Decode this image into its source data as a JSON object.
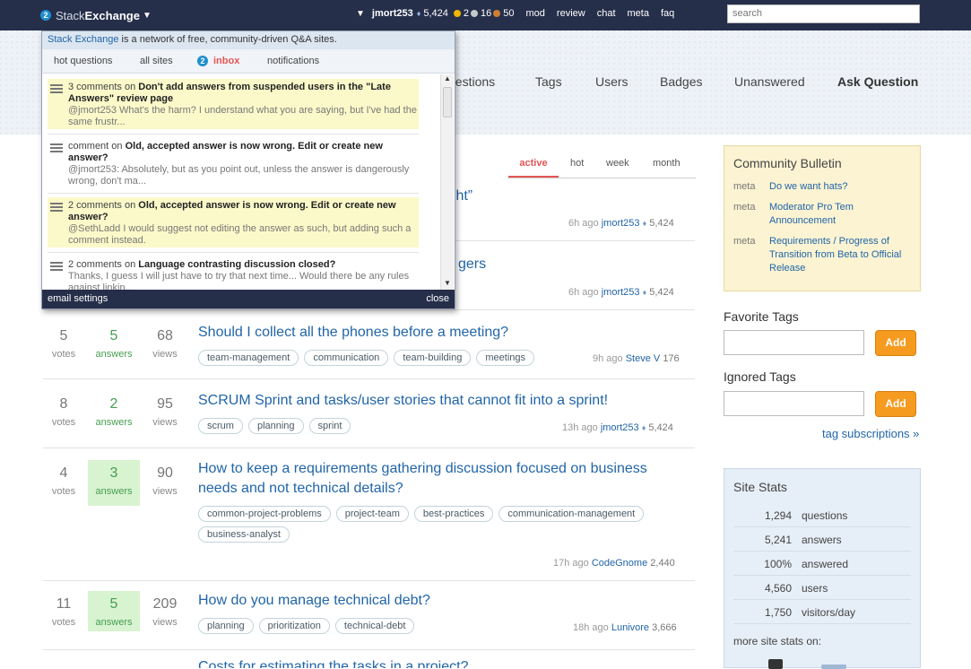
{
  "topbar": {
    "logo_light": "Stack",
    "logo_bold": "Exchange",
    "badge": "2",
    "user": {
      "name": "jmort253",
      "rep": "5,424",
      "gold": "2",
      "silver": "16",
      "bronze": "50"
    },
    "links": [
      "mod",
      "review",
      "chat",
      "meta",
      "faq"
    ],
    "search_placeholder": "search"
  },
  "nav": {
    "questions": "uestions",
    "tags": "Tags",
    "users": "Users",
    "badges": "Badges",
    "unanswered": "Unanswered",
    "ask": "Ask Question"
  },
  "sort_tabs": {
    "active": "active",
    "hot": "hot",
    "week": "week",
    "month": "month"
  },
  "partial_titles": {
    "q1": "ight”",
    "q2": "gers"
  },
  "questions": [
    {
      "meta_time": "6h ago",
      "user": "jmort253",
      "rep": "5,424"
    },
    {
      "meta_time": "6h ago",
      "user": "jmort253",
      "rep": "5,424"
    },
    {
      "votes": "5",
      "answers": "5",
      "views": "68",
      "title": "Should I collect all the phones before a meeting?",
      "tags": [
        "team-management",
        "communication",
        "team-building",
        "meetings"
      ],
      "meta_time": "9h ago",
      "user": "Steve V",
      "rep": "176"
    },
    {
      "votes": "8",
      "answers": "2",
      "views": "95",
      "title": "SCRUM Sprint and tasks/user stories that cannot fit into a sprint!",
      "tags": [
        "scrum",
        "planning",
        "sprint"
      ],
      "meta_time": "13h ago",
      "user": "jmort253",
      "rep": "5,424"
    },
    {
      "votes": "4",
      "answers": "3",
      "views": "90",
      "title": "How to keep a requirements gathering discussion focused on business needs and not technical details?",
      "tags": [
        "common-project-problems",
        "project-team",
        "best-practices",
        "communication-management",
        "business-analyst"
      ],
      "meta_time": "17h ago",
      "user": "CodeGnome",
      "rep": "2,440"
    },
    {
      "votes": "11",
      "answers": "5",
      "views": "209",
      "title": "How do you manage technical debt?",
      "tags": [
        "planning",
        "prioritization",
        "technical-debt"
      ],
      "meta_time": "18h ago",
      "user": "Lunivore",
      "rep": "3,666"
    },
    {
      "title": "Costs for estimating the tasks in a project?"
    }
  ],
  "labels": {
    "votes": "votes",
    "answers": "answers",
    "views": "views"
  },
  "bulletin": {
    "title": "Community Bulletin",
    "items": [
      {
        "site": "meta",
        "text": "Do we want hats?"
      },
      {
        "site": "meta",
        "text": "Moderator Pro Tem Announcement"
      },
      {
        "site": "meta",
        "text": "Requirements / Progress of Transition from Beta to Official Release"
      }
    ]
  },
  "favorite_tags": {
    "label": "Favorite Tags",
    "button": "Add"
  },
  "ignored_tags": {
    "label": "Ignored Tags",
    "button": "Add"
  },
  "tag_subscriptions": "tag subscriptions »",
  "site_stats": {
    "title": "Site Stats",
    "rows": [
      {
        "n": "1,294",
        "l": "questions"
      },
      {
        "n": "5,241",
        "l": "answers"
      },
      {
        "n": "100%",
        "l": "answered"
      },
      {
        "n": "4,560",
        "l": "users"
      },
      {
        "n": "1,750",
        "l": "visitors/day"
      }
    ],
    "more": "more site stats on:"
  },
  "dropdown": {
    "head_link": "Stack Exchange",
    "head_rest": " is a network of free, community-driven Q&A sites.",
    "tabs": [
      "hot questions",
      "all sites",
      "inbox",
      "notifications"
    ],
    "inbox_badge": "2",
    "items": [
      {
        "pre": "3 comments on ",
        "title": "Don't add answers from suspended users in the \"Late Answers\" review page",
        "body": "@jmort253 What's the harm? I understand what you are saying, but I've had the same frustr..."
      },
      {
        "pre": "comment on ",
        "title": "Old, accepted answer is now wrong. Edit or create new answer?",
        "body": "@jmort253: Absolutely, but as you point out, unless the answer is dangerously wrong, don't ma..."
      },
      {
        "pre": "2 comments on ",
        "title": "Old, accepted answer is now wrong. Edit or create new answer?",
        "body": "@SethLadd I would suggest not editing the answer as such, but adding such a comment instead."
      },
      {
        "pre": "2 comments on ",
        "title": "Language contrasting discussion closed?",
        "body": "Thanks, I guess I will just have to try that next time... Would there be any rules against linkin..."
      }
    ],
    "footer_left": "email settings",
    "footer_right": "close"
  }
}
